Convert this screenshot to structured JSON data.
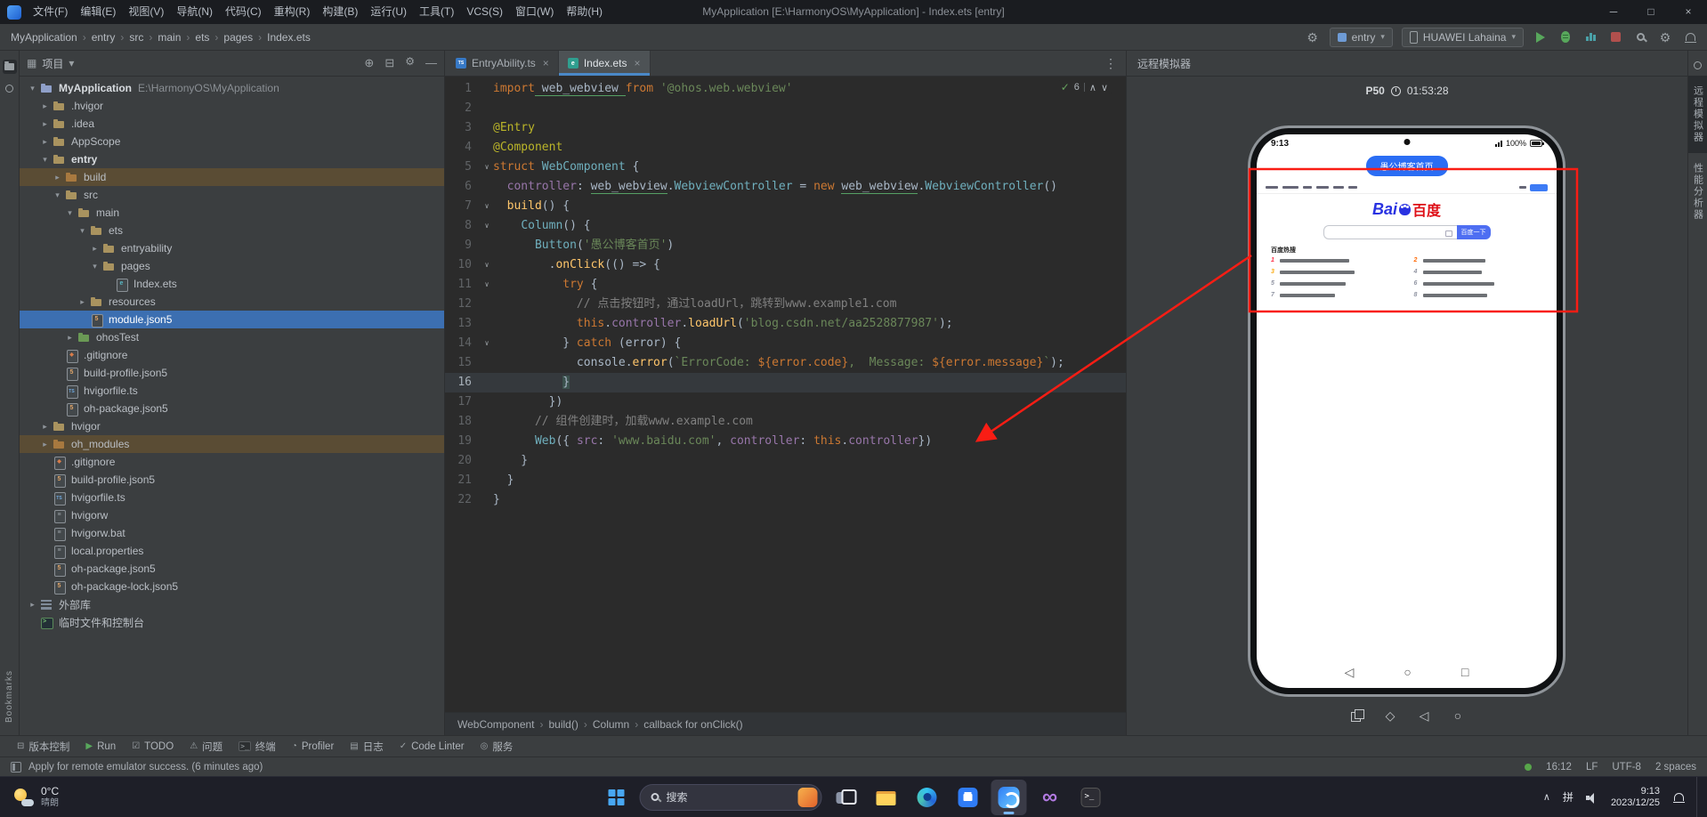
{
  "colors": {
    "selection_blue": "#3c6fb1",
    "excluded_brown": "#5a4c34",
    "annotation_red": "#f91d14",
    "run_green": "#58a75c",
    "stop_red": "#c75450",
    "baidu_blue": "#2932e1",
    "baidu_red": "#de0f17",
    "harmony_button_blue": "#2a6df4",
    "active_tab_underline": "#4a88c7"
  },
  "title_bar": {
    "menus": [
      "文件(F)",
      "编辑(E)",
      "视图(V)",
      "导航(N)",
      "代码(C)",
      "重构(R)",
      "构建(B)",
      "运行(U)",
      "工具(T)",
      "VCS(S)",
      "窗口(W)",
      "帮助(H)"
    ],
    "title": "MyApplication [E:\\HarmonyOS\\MyApplication] - Index.ets [entry]"
  },
  "toolbar": {
    "breadcrumbs": [
      "MyApplication",
      "entry",
      "src",
      "main",
      "ets",
      "pages",
      "Index.ets"
    ],
    "run_config": "entry",
    "device": "HUAWEI Lahaina"
  },
  "project": {
    "header": "项目",
    "tree": [
      {
        "label": "MyApplication",
        "sub": "E:\\HarmonyOS\\MyApplication",
        "depth": 0,
        "icon": "folder-project",
        "arrow": "down",
        "bold": true
      },
      {
        "label": ".hvigor",
        "depth": 1,
        "icon": "folder",
        "arrow": "right"
      },
      {
        "label": ".idea",
        "depth": 1,
        "icon": "folder",
        "arrow": "right"
      },
      {
        "label": "AppScope",
        "depth": 1,
        "icon": "folder",
        "arrow": "right"
      },
      {
        "label": "entry",
        "depth": 1,
        "icon": "folder",
        "arrow": "down",
        "bold": true
      },
      {
        "label": "build",
        "depth": 2,
        "icon": "folder-excluded",
        "arrow": "right",
        "hl": "excluded"
      },
      {
        "label": "src",
        "depth": 2,
        "icon": "folder",
        "arrow": "down"
      },
      {
        "label": "main",
        "depth": 3,
        "icon": "folder",
        "arrow": "down"
      },
      {
        "label": "ets",
        "depth": 4,
        "icon": "folder",
        "arrow": "down"
      },
      {
        "label": "entryability",
        "depth": 5,
        "icon": "folder",
        "arrow": "right"
      },
      {
        "label": "pages",
        "depth": 5,
        "icon": "folder",
        "arrow": "down"
      },
      {
        "label": "Index.ets",
        "depth": 6,
        "icon": "file-ets"
      },
      {
        "label": "resources",
        "depth": 4,
        "icon": "folder",
        "arrow": "right"
      },
      {
        "label": "module.json5",
        "depth": 4,
        "icon": "file-json5",
        "hl": "selected"
      },
      {
        "label": "ohosTest",
        "depth": 3,
        "icon": "folder-test",
        "arrow": "right"
      },
      {
        "label": ".gitignore",
        "depth": 2,
        "icon": "file-git"
      },
      {
        "label": "build-profile.json5",
        "depth": 2,
        "icon": "file-json5"
      },
      {
        "label": "hvigorfile.ts",
        "depth": 2,
        "icon": "file-ts"
      },
      {
        "label": "oh-package.json5",
        "depth": 2,
        "icon": "file-json5"
      },
      {
        "label": "hvigor",
        "depth": 1,
        "icon": "folder",
        "arrow": "right"
      },
      {
        "label": "oh_modules",
        "depth": 1,
        "icon": "folder-excluded",
        "arrow": "right",
        "hl": "excluded"
      },
      {
        "label": ".gitignore",
        "depth": 1,
        "icon": "file-git"
      },
      {
        "label": "build-profile.json5",
        "depth": 1,
        "icon": "file-json5"
      },
      {
        "label": "hvigorfile.ts",
        "depth": 1,
        "icon": "file-ts"
      },
      {
        "label": "hvigorw",
        "depth": 1,
        "icon": "file-plain"
      },
      {
        "label": "hvigorw.bat",
        "depth": 1,
        "icon": "file-plain"
      },
      {
        "label": "local.properties",
        "depth": 1,
        "icon": "file-plain"
      },
      {
        "label": "oh-package.json5",
        "depth": 1,
        "icon": "file-json5"
      },
      {
        "label": "oh-package-lock.json5",
        "depth": 1,
        "icon": "file-json5"
      },
      {
        "label": "外部库",
        "depth": 0,
        "icon": "lib",
        "arrow": "right"
      },
      {
        "label": "临时文件和控制台",
        "depth": 0,
        "icon": "console"
      }
    ]
  },
  "editor": {
    "tabs": [
      {
        "label": "EntryAbility.ts",
        "icon": "ts",
        "active": false
      },
      {
        "label": "Index.ets",
        "icon": "ets",
        "active": true
      }
    ],
    "inspection_count": "6",
    "current_line": 16,
    "fold_lines": [
      5,
      7,
      8,
      10,
      11,
      14
    ],
    "lines": [
      [
        [
          "k",
          "import"
        ],
        [
          "u",
          " web_webview "
        ],
        [
          "k",
          "from"
        ],
        [
          "s",
          " '@ohos.web.webview'"
        ]
      ],
      [],
      [
        [
          "a",
          "@Entry"
        ]
      ],
      [
        [
          "a",
          "@Component"
        ]
      ],
      [
        [
          "k",
          "struct"
        ],
        [
          "t",
          " WebComponent "
        ],
        [
          "d",
          "{"
        ]
      ],
      [
        [
          "d",
          "  "
        ],
        [
          "p",
          "controller"
        ],
        [
          "d",
          ": "
        ],
        [
          "u",
          "web_webview"
        ],
        [
          "d",
          "."
        ],
        [
          "t",
          "WebviewController"
        ],
        [
          "d",
          " = "
        ],
        [
          "k",
          "new"
        ],
        [
          "d",
          " "
        ],
        [
          "u",
          "web_webview"
        ],
        [
          "d",
          "."
        ],
        [
          "t",
          "WebviewController"
        ],
        [
          "d",
          "()"
        ]
      ],
      [
        [
          "d",
          "  "
        ],
        [
          "f",
          "build"
        ],
        [
          "d",
          "() {"
        ]
      ],
      [
        [
          "d",
          "    "
        ],
        [
          "t",
          "Column"
        ],
        [
          "d",
          "() {"
        ]
      ],
      [
        [
          "d",
          "      "
        ],
        [
          "t",
          "Button"
        ],
        [
          "d",
          "("
        ],
        [
          "s",
          "'愚公博客首页'"
        ],
        [
          "d",
          ")"
        ]
      ],
      [
        [
          "d",
          "        ."
        ],
        [
          "f",
          "onClick"
        ],
        [
          "d",
          "(() => {"
        ]
      ],
      [
        [
          "d",
          "          "
        ],
        [
          "k",
          "try"
        ],
        [
          "d",
          " {"
        ]
      ],
      [
        [
          "d",
          "            "
        ],
        [
          "c",
          "// 点击按钮时，通过loadUrl，跳转到www.example1.com"
        ]
      ],
      [
        [
          "d",
          "            "
        ],
        [
          "k",
          "this"
        ],
        [
          "d",
          "."
        ],
        [
          "p",
          "controller"
        ],
        [
          "d",
          "."
        ],
        [
          "f",
          "loadUrl"
        ],
        [
          "d",
          "("
        ],
        [
          "s",
          "'blog.csdn.net/aa2528877987'"
        ],
        [
          "d",
          ");"
        ]
      ],
      [
        [
          "d",
          "          } "
        ],
        [
          "k",
          "catch"
        ],
        [
          "d",
          " (error) {"
        ]
      ],
      [
        [
          "d",
          "            console."
        ],
        [
          "f",
          "error"
        ],
        [
          "d",
          "("
        ],
        [
          "s",
          "`ErrorCode: "
        ],
        [
          "e",
          "${error.code}"
        ],
        [
          "s",
          ",  Message: "
        ],
        [
          "e",
          "${error.message}"
        ],
        [
          "s",
          "`"
        ],
        [
          "d",
          ");"
        ]
      ],
      [
        [
          "d",
          "          "
        ],
        [
          "bm",
          "}"
        ]
      ],
      [
        [
          "d",
          "        })"
        ]
      ],
      [
        [
          "d",
          "      "
        ],
        [
          "c",
          "// 组件创建时，加载www.example.com"
        ]
      ],
      [
        [
          "d",
          "      "
        ],
        [
          "t",
          "Web"
        ],
        [
          "d",
          "({ "
        ],
        [
          "p",
          "src"
        ],
        [
          "d",
          ": "
        ],
        [
          "s",
          "'www.baidu.com'"
        ],
        [
          "d",
          ", "
        ],
        [
          "p",
          "controller"
        ],
        [
          "d",
          ": "
        ],
        [
          "k",
          "this"
        ],
        [
          "d",
          "."
        ],
        [
          "p",
          "controller"
        ],
        [
          "d",
          "})"
        ]
      ],
      [
        [
          "d",
          "    }"
        ]
      ],
      [
        [
          "d",
          "  }"
        ]
      ],
      [
        [
          "d",
          "}"
        ]
      ]
    ],
    "breadcrumb": [
      "WebComponent",
      "build()",
      "Column",
      "callback for onClick()"
    ]
  },
  "emulator": {
    "title": "远程模拟器",
    "device_name": "P50",
    "timer": "01:53:28",
    "phone": {
      "status_time": "9:13",
      "battery": "100%",
      "app_button": "愚公博客首页",
      "web": {
        "logo_left": "Bai",
        "logo_right": "百度",
        "search_button": "百度一下",
        "hot_title": "百度热搜",
        "hot_ranks": [
          "1",
          "2",
          "3",
          "4",
          "5",
          "6",
          "7",
          "8"
        ]
      },
      "nav": [
        "back",
        "home",
        "recents"
      ]
    },
    "controls": [
      "screenshot",
      "rotate",
      "back",
      "home"
    ]
  },
  "stripes": {
    "left_bottom_label": "Bookmarks",
    "right_items": [
      {
        "label": "远程模拟器",
        "active": true
      },
      {
        "label": "性能分析器",
        "active": false
      }
    ]
  },
  "bottom_bar": [
    {
      "icon": "vcs",
      "label": "版本控制"
    },
    {
      "icon": "run",
      "label": "Run"
    },
    {
      "icon": "todo",
      "label": "TODO"
    },
    {
      "icon": "problems",
      "label": "问题"
    },
    {
      "icon": "terminal",
      "label": "终端"
    },
    {
      "icon": "profiler",
      "label": "Profiler"
    },
    {
      "icon": "log",
      "label": "日志"
    },
    {
      "icon": "lint",
      "label": "Code Linter"
    },
    {
      "icon": "services",
      "label": "服务"
    }
  ],
  "status_bar": {
    "message": "Apply for remote emulator success. (6 minutes ago)",
    "cursor": "16:12",
    "line_sep": "LF",
    "encoding": "UTF-8",
    "indent": "2 spaces"
  },
  "taskbar": {
    "weather_temp": "0°C",
    "weather_desc": "晴朗",
    "search": "搜索",
    "apps": [
      "task-view",
      "explorer",
      "edge",
      "store",
      "deveco",
      "visual-studio",
      "terminal"
    ],
    "ime": "拼",
    "time": "9:13",
    "date": "2023/12/25"
  }
}
